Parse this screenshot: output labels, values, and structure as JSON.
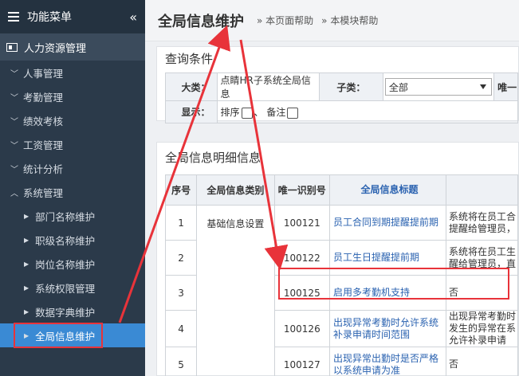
{
  "sidebar": {
    "header": "功能菜单",
    "collapse_icon": "«",
    "module": "人力资源管理",
    "items": [
      {
        "label": "人事管理",
        "icon": "chevron-down"
      },
      {
        "label": "考勤管理",
        "icon": "chevron-down"
      },
      {
        "label": "绩效考核",
        "icon": "chevron-down"
      },
      {
        "label": "工资管理",
        "icon": "chevron-down"
      },
      {
        "label": "统计分析",
        "icon": "chevron-down"
      },
      {
        "label": "系统管理",
        "icon": "chevron-up"
      }
    ],
    "sub_items": [
      {
        "label": "部门名称维护"
      },
      {
        "label": "职级名称维护"
      },
      {
        "label": "岗位名称维护"
      },
      {
        "label": "系统权限管理"
      },
      {
        "label": "数据字典维护"
      },
      {
        "label": "全局信息维护",
        "active": true
      }
    ]
  },
  "header": {
    "title": "全局信息维护",
    "links": [
      "» 本页面帮助",
      "» 本模块帮助"
    ]
  },
  "query": {
    "title": "查询条件",
    "category_label": "大类：",
    "category_value": "点睛HR子系统全局信息",
    "subtype_label": "子类：",
    "subtype_value": "全部",
    "extra_label": "唯一",
    "display_label": "显示：",
    "sort_label": "排序",
    "sep": "、",
    "remark_label": "备注"
  },
  "detail": {
    "title": "全局信息明细信息",
    "columns": [
      "序号",
      "全局信息类别",
      "唯一识别号",
      "全局信息标题",
      ""
    ],
    "category_cell": "基础信息设置",
    "rows": [
      {
        "no": "1",
        "id": "100121",
        "title": "员工合同到期提醒提前期",
        "desc": "系统将在员工合\n提醒给管理员，"
      },
      {
        "no": "2",
        "id": "100122",
        "title": "员工生日提醒提前期",
        "desc": "系统将在员工生\n醒给管理员，直"
      },
      {
        "no": "3",
        "id": "100125",
        "title": "启用多考勤机支持",
        "desc": "否"
      },
      {
        "no": "4",
        "id": "100126",
        "title": "出现异常考勤时允许系统\n补录申请时间范围",
        "desc": "出现异常考勤时\n发生的异常在系\n允许补录申请"
      },
      {
        "no": "5",
        "id": "100127",
        "title": "出现异常出勤时是否严格\n以系统申请为准",
        "desc": "否"
      }
    ]
  },
  "colors": {
    "sidebar_bg": "#2b3a4a",
    "active_bg": "#3a8ad4",
    "annotation_red": "#e8333a",
    "link_blue": "#2a62b0"
  }
}
